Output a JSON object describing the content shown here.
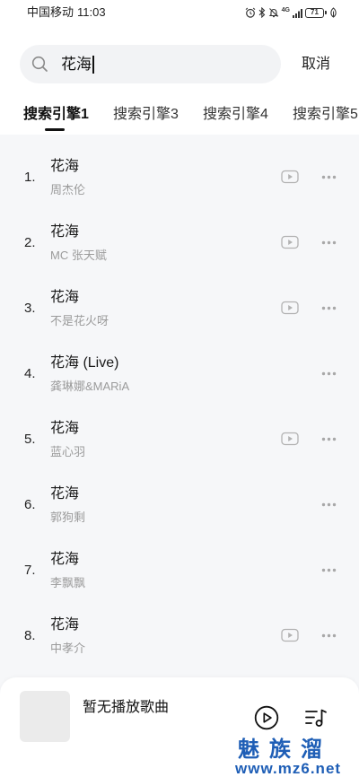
{
  "status_bar": {
    "carrier": "中国移动",
    "time": "11:03",
    "network": "4G",
    "battery": "71"
  },
  "search": {
    "query": "花海",
    "cancel_label": "取消"
  },
  "tabs": [
    {
      "label": "搜索引擎1",
      "selected": true
    },
    {
      "label": "搜索引擎3",
      "selected": false
    },
    {
      "label": "搜索引擎4",
      "selected": false
    },
    {
      "label": "搜索引擎5",
      "selected": false
    }
  ],
  "results": [
    {
      "index": "1.",
      "title": "花海",
      "artist": "周杰伦",
      "has_video": true
    },
    {
      "index": "2.",
      "title": "花海",
      "artist": "MC 张天赋",
      "has_video": true
    },
    {
      "index": "3.",
      "title": "花海",
      "artist": "不是花火呀",
      "has_video": true
    },
    {
      "index": "4.",
      "title": "花海 (Live)",
      "artist": "龚琳娜&MARiA",
      "has_video": false
    },
    {
      "index": "5.",
      "title": "花海",
      "artist": "蓝心羽",
      "has_video": true
    },
    {
      "index": "6.",
      "title": "花海",
      "artist": "郭狗剩",
      "has_video": false
    },
    {
      "index": "7.",
      "title": "花海",
      "artist": "李飘飘",
      "has_video": false
    },
    {
      "index": "8.",
      "title": "花海",
      "artist": "中孝介",
      "has_video": true
    }
  ],
  "player": {
    "now_playing": "暂无播放歌曲"
  },
  "watermark": {
    "brand": "魅族溜",
    "url": "www.mz6.net"
  },
  "icons": {
    "status": [
      "alarm-icon",
      "bluetooth-icon",
      "mute-icon",
      "signal-icon",
      "battery-icon",
      "leaf-icon"
    ],
    "search": "search-icon",
    "row_actions": [
      "video-icon",
      "more-options-icon"
    ],
    "player": [
      "play-circle-icon",
      "playlist-icon"
    ]
  },
  "colors": {
    "text_primary": "#1a1a1a",
    "text_secondary": "#9b9b9b",
    "list_background": "#f6f7f9",
    "search_background": "#f2f3f5",
    "icon_gray": "#b2b2b2",
    "watermark_blue": "#1e5eb6"
  }
}
